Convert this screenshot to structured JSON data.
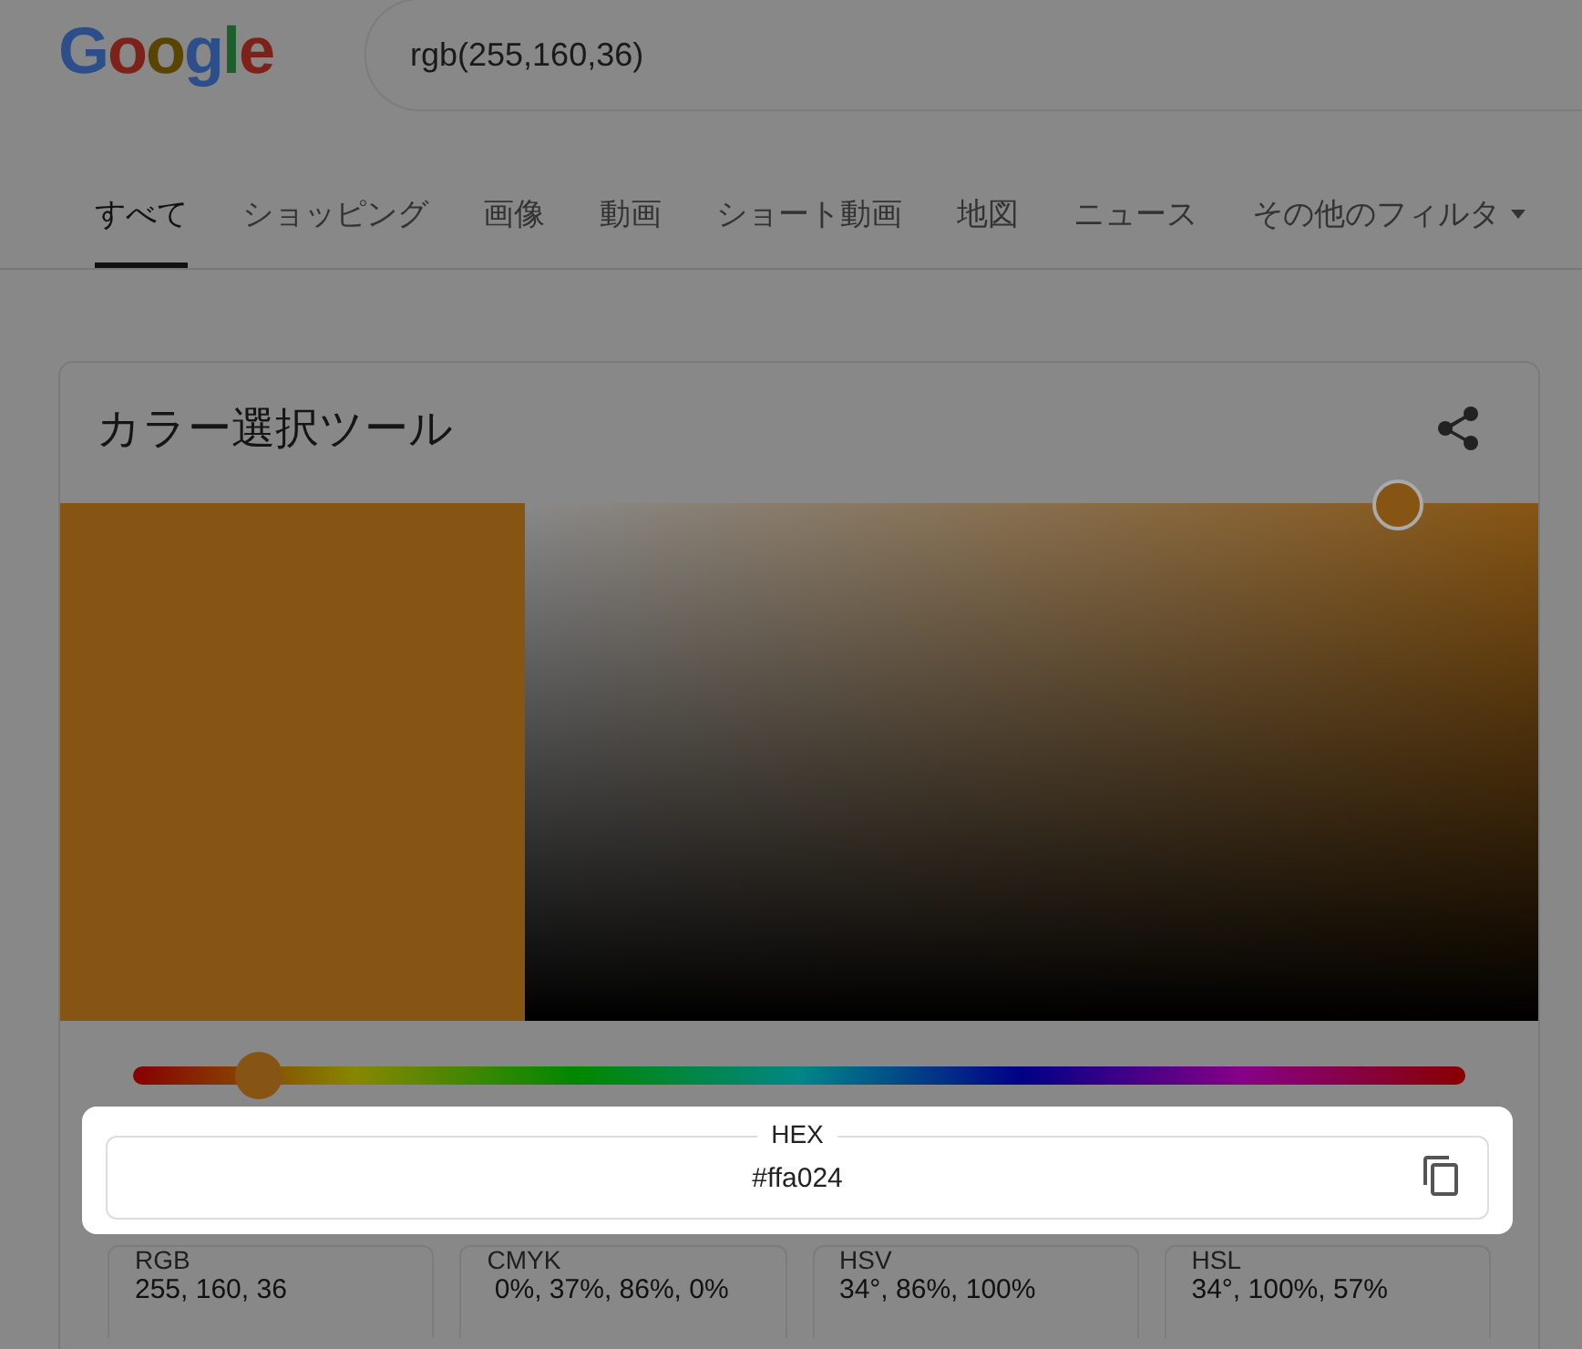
{
  "logo": "Google",
  "search": {
    "value": "rgb(255,160,36)"
  },
  "tabs": [
    {
      "label": "すべて",
      "selected": true
    },
    {
      "label": "ショッピング",
      "selected": false
    },
    {
      "label": "画像",
      "selected": false
    },
    {
      "label": "動画",
      "selected": false
    },
    {
      "label": "ショート動画",
      "selected": false
    },
    {
      "label": "地図",
      "selected": false
    },
    {
      "label": "ニュース",
      "selected": false
    },
    {
      "label": "その他のフィルタ",
      "selected": false,
      "kind": "dropdown"
    }
  ],
  "card": {
    "title": "カラー選択ツール",
    "swatch": {
      "color": "#875513"
    },
    "saturation": {
      "level": 0.86
    },
    "hue": {
      "level": 0.094
    },
    "hex": {
      "label": "HEX",
      "value": "#ffa024"
    },
    "formats": [
      {
        "label": "RGB",
        "value": "255, 160, 36"
      },
      {
        "label": "CMYK",
        "value": " 0%, 37%, 86%, 0%"
      },
      {
        "label": "HSV",
        "value": "34°, 86%, 100%"
      },
      {
        "label": "HSL",
        "value": "34°, 100%, 57%"
      }
    ]
  }
}
